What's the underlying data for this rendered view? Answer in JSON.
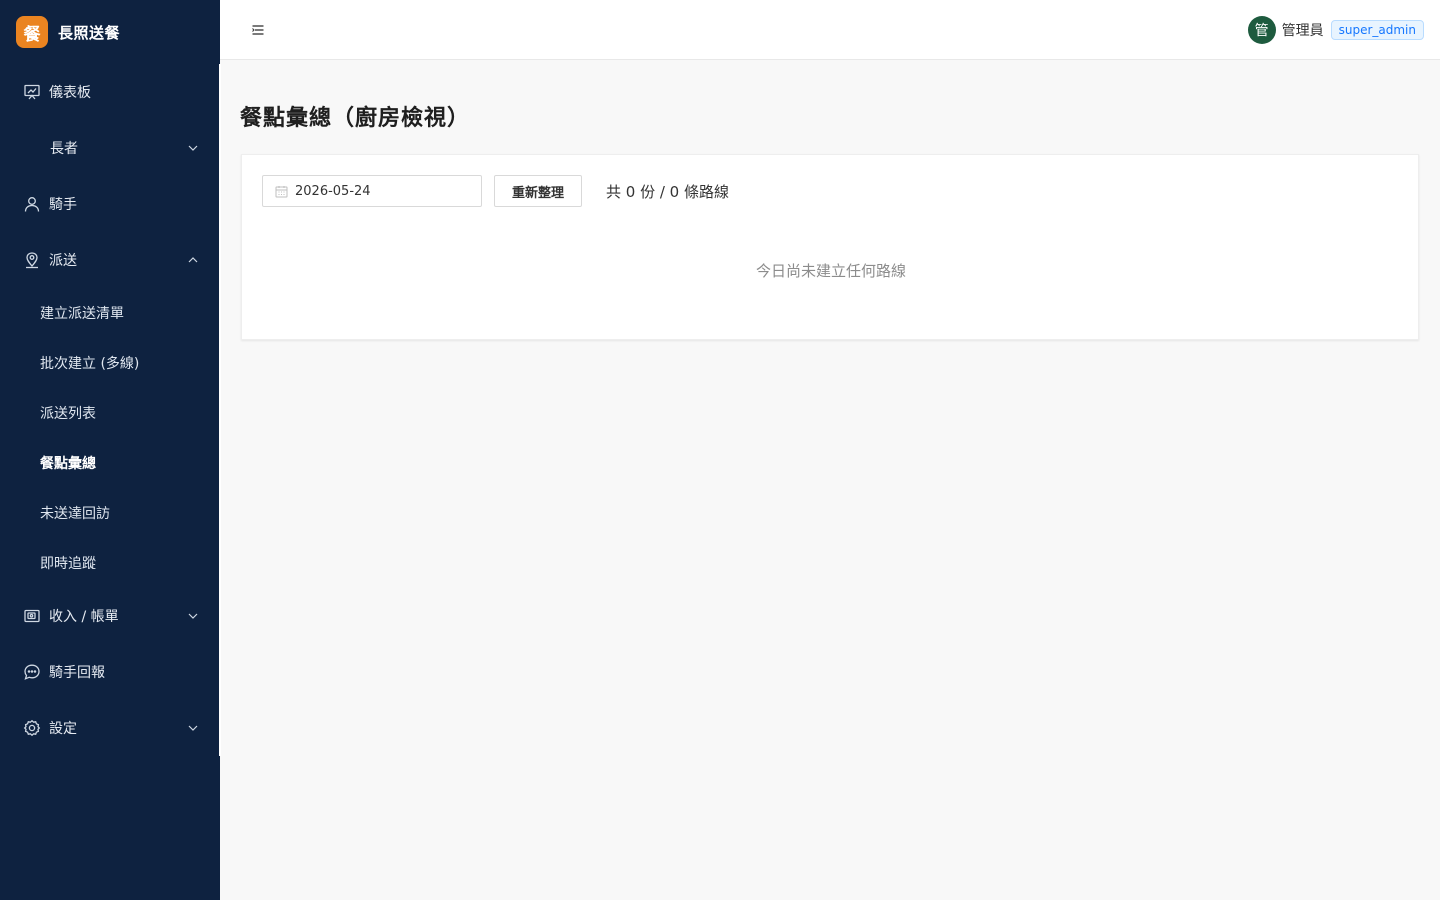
{
  "brand": {
    "logo_char": "餐",
    "name": "長照送餐"
  },
  "sidebar": {
    "items": [
      {
        "label": "儀表板",
        "icon": "presentation-chart-icon"
      },
      {
        "label": "長者",
        "icon": "none",
        "expandable": true
      },
      {
        "label": "騎手",
        "icon": "user-icon"
      },
      {
        "label": "派送",
        "icon": "map-pin-icon",
        "expanded": true
      },
      {
        "label": "收入 / 帳單",
        "icon": "wallet-icon",
        "expandable": true
      },
      {
        "label": "騎手回報",
        "icon": "chat-bubble-icon"
      },
      {
        "label": "設定",
        "icon": "gear-icon",
        "expandable": true
      }
    ],
    "dispatch_sub": [
      {
        "label": "建立派送清單"
      },
      {
        "label": "批次建立 (多線)"
      },
      {
        "label": "派送列表"
      },
      {
        "label": "餐點彙總",
        "active": true
      },
      {
        "label": "未送達回訪"
      },
      {
        "label": "即時追蹤"
      }
    ]
  },
  "header": {
    "avatar_char": "管",
    "user_name": "管理員",
    "role": "super_admin"
  },
  "main": {
    "title": "餐點彙總（廚房檢視）",
    "date_value": "2026-05-24",
    "refresh_label": "重新整理",
    "summary": "共 0 份 / 0 條路線",
    "empty_text": "今日尚未建立任何路線"
  },
  "colors": {
    "sidebar_bg": "#0e2240",
    "brand_accent": "#ea8421",
    "avatar_bg": "#1e5b3f",
    "tag_blue": "#1677ff"
  }
}
